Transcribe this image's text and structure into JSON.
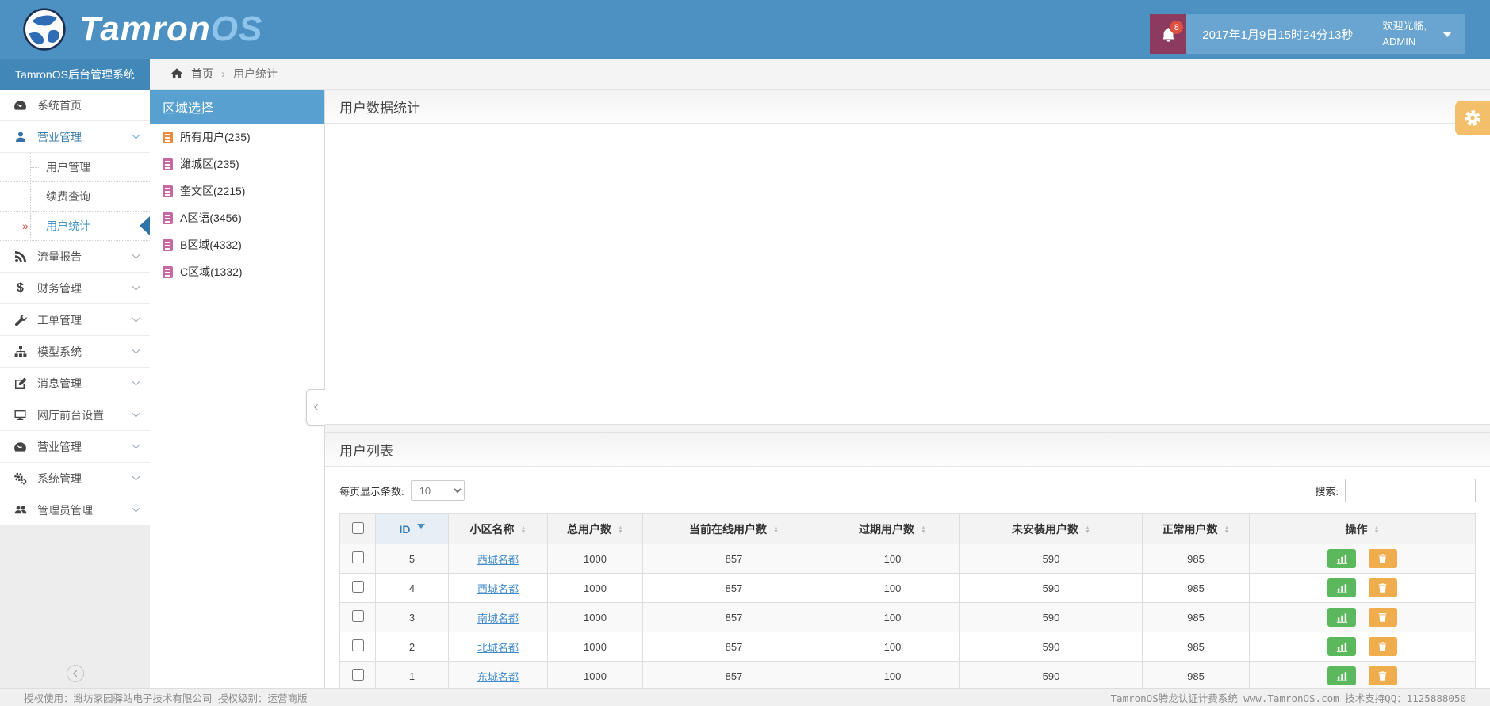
{
  "header": {
    "logo_text": "Tamron",
    "logo_suffix": "OS",
    "notification_count": "8",
    "datetime": "2017年1月9日15时24分13秒",
    "welcome": "欢迎光临,",
    "username": "ADMIN"
  },
  "sidebar": {
    "title": "TamronOS后台管理系统",
    "menu": [
      {
        "label": "系统首页"
      },
      {
        "label": "营业管理"
      },
      {
        "label": "流量报告"
      },
      {
        "label": "财务管理"
      },
      {
        "label": "工单管理"
      },
      {
        "label": "模型系统"
      },
      {
        "label": "消息管理"
      },
      {
        "label": "网厅前台设置"
      },
      {
        "label": "营业管理"
      },
      {
        "label": "系统管理"
      },
      {
        "label": "管理员管理"
      }
    ],
    "submenu": [
      {
        "label": "用户管理"
      },
      {
        "label": "续费查询"
      },
      {
        "label": "用户统计"
      }
    ]
  },
  "breadcrumb": {
    "home": "首页",
    "current": "用户统计"
  },
  "region": {
    "title": "区域选择",
    "items": [
      {
        "label": "所有用户(235)"
      },
      {
        "label": "潍城区(235)"
      },
      {
        "label": "奎文区(2215)"
      },
      {
        "label": "A区语(3456)"
      },
      {
        "label": "B区域(4332)"
      },
      {
        "label": "C区域(1332)"
      }
    ]
  },
  "panels": {
    "stats_title": "用户数据统计",
    "list_title": "用户列表"
  },
  "toolbar": {
    "page_size_label": "每页显示条数:",
    "page_size_value": "10",
    "search_label": "搜索:"
  },
  "users_table": {
    "columns": [
      "ID",
      "小区名称",
      "总用户数",
      "当前在线用户数",
      "过期用户数",
      "未安装用户数",
      "正常用户数",
      "操作"
    ],
    "rows": [
      {
        "id": "5",
        "name": "西城名都",
        "total": "1000",
        "online": "857",
        "expired": "100",
        "uninstalled": "590",
        "normal": "985"
      },
      {
        "id": "4",
        "name": "西城名都",
        "total": "1000",
        "online": "857",
        "expired": "100",
        "uninstalled": "590",
        "normal": "985"
      },
      {
        "id": "3",
        "name": "南城名都",
        "total": "1000",
        "online": "857",
        "expired": "100",
        "uninstalled": "590",
        "normal": "985"
      },
      {
        "id": "2",
        "name": "北城名都",
        "total": "1000",
        "online": "857",
        "expired": "100",
        "uninstalled": "590",
        "normal": "985"
      },
      {
        "id": "1",
        "name": "东城名都",
        "total": "1000",
        "online": "857",
        "expired": "100",
        "uninstalled": "590",
        "normal": "985"
      }
    ]
  },
  "footer": {
    "left": "授权使用：潍坊家园驿站电子技术有限公司  授权级别：运营商版",
    "right": "TamronOS腾龙认证计费系统  www.TamronOS.com  技术支持QQ：1125888050"
  },
  "colors": {
    "header_blue": "#4d91c2",
    "sidebar_title_blue": "#4187b8",
    "region_header_blue": "#58a0cf",
    "notification_bg": "#8c3a60",
    "badge_red": "#dc5040",
    "link_blue": "#428bca",
    "success_green": "#5cb85c",
    "warning_orange": "#f0ad4e",
    "region_icon_orange": "#ef8a3d",
    "region_icon_pink": "#c767a4",
    "gear_button_orange": "#f3bf6a"
  }
}
